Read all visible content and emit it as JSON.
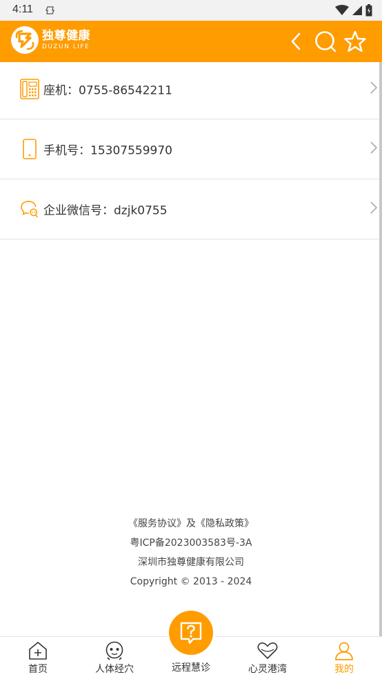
{
  "status_bar": {
    "time": "4:11"
  },
  "header": {
    "logo_cn": "独尊健康",
    "logo_en": "DUZUN  LIFE"
  },
  "contacts": [
    {
      "label": "座机：",
      "value": "0755-86542211",
      "icon": "landline-phone-icon"
    },
    {
      "label": "手机号：",
      "value": "15307559970",
      "icon": "mobile-phone-icon"
    },
    {
      "label": "企业微信号：",
      "value": "dzjk0755",
      "icon": "wechat-icon"
    }
  ],
  "footer": {
    "agreement": "《服务协议》",
    "and": "及",
    "privacy": "《隐私政策》",
    "icp": "粤ICP备2023003583号-3A",
    "company": "深圳市独尊健康有限公司",
    "copyright": "Copyright © 2013 - 2024"
  },
  "bottom_nav": {
    "items": [
      {
        "label": "首页",
        "icon": "home-icon"
      },
      {
        "label": "人体经穴",
        "icon": "meridian-face-icon"
      },
      {
        "label": "远程慧诊",
        "icon": "question-bubble-icon"
      },
      {
        "label": "心灵港湾",
        "icon": "heart-icon"
      },
      {
        "label": "我的",
        "icon": "user-icon"
      }
    ],
    "active_index": 4
  },
  "colors": {
    "brand": "#ff9c00",
    "text": "#333333",
    "divider": "#e3e3e3"
  }
}
